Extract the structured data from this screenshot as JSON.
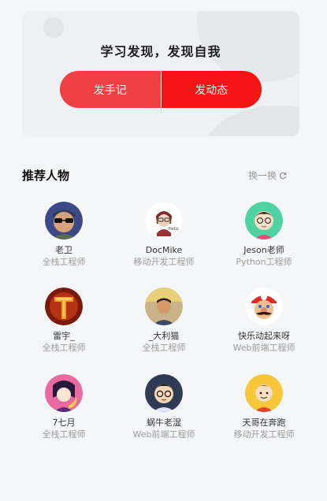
{
  "hero": {
    "title": "学习发现，发现自我",
    "note_button": "发手记",
    "post_button": "发动态",
    "accent": "#f51414"
  },
  "recommend": {
    "title": "推荐人物",
    "refresh_label": "换一换"
  },
  "people": [
    {
      "name": "老卫",
      "role": "全栈工程师"
    },
    {
      "name": "DocMike",
      "role": "移动开发工程师"
    },
    {
      "name": "Jeson老师",
      "role": "Python工程师"
    },
    {
      "name": "雷宇_",
      "role": "全栈工程师"
    },
    {
      "name": "_大利猫",
      "role": "全栈工程师"
    },
    {
      "name": "快乐动起来呀",
      "role": "Web前端工程师"
    },
    {
      "name": "7七月",
      "role": "全栈工程师"
    },
    {
      "name": "蜗牛老湿",
      "role": "Web前端工程师"
    },
    {
      "name": "天哥在奔跑",
      "role": "移动开发工程师"
    }
  ]
}
